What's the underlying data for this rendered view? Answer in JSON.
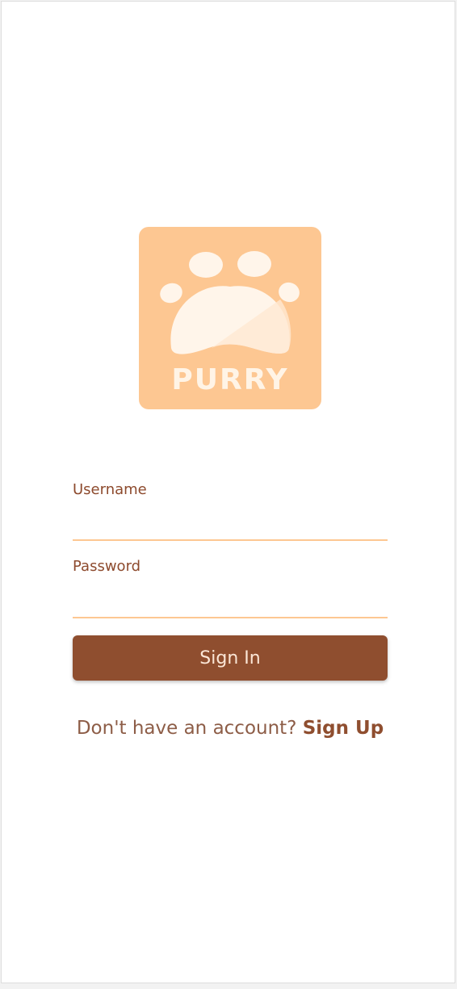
{
  "app": {
    "name": "PURRY"
  },
  "login_form": {
    "username_label": "Username",
    "username_value": "",
    "password_label": "Password",
    "password_value": "",
    "sign_in_label": "Sign In"
  },
  "footer": {
    "prompt": "Don't have an account?",
    "sign_up_label": "Sign Up"
  },
  "colors": {
    "logo_background": "#fdc792",
    "primary_button": "#8f4e2f",
    "text_brown": "#8d4a2d",
    "input_underline": "#fdc792"
  },
  "icons": {
    "logo": "paw-print-icon"
  }
}
